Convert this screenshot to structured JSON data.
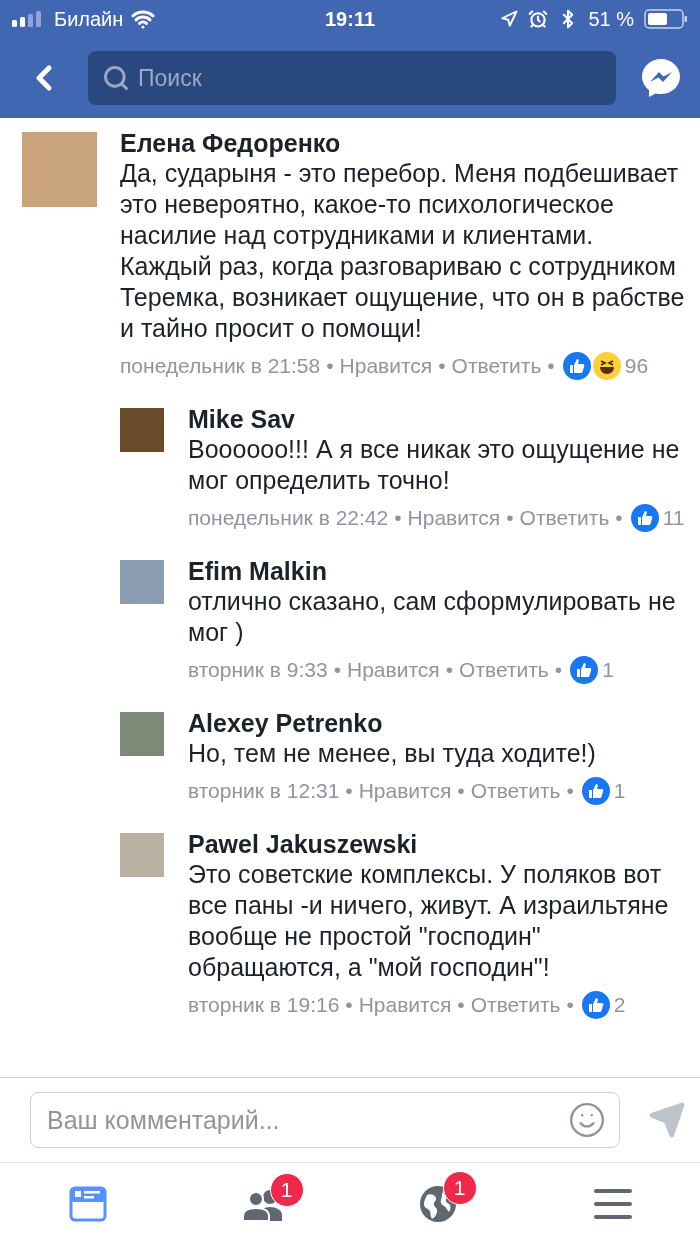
{
  "status_bar": {
    "carrier": "Билайн",
    "time": "19:11",
    "battery": "51 %"
  },
  "nav": {
    "search": {
      "placeholder": "Поиск"
    }
  },
  "comments": [
    {
      "author": "Елена Федоренко",
      "text": "Да, сударыня - это перебор. Меня подбешивает это невероятно, какое-то психологическое насилие над сотрудниками и клиентами. Каждый раз, когда разговариваю с сотрудником Теремка, возникает ощущение, что он в рабстве и тайно просит о помощи!",
      "time": "понедельник в 21:58",
      "like": "Нравится",
      "reply": "Ответить",
      "separator": "•",
      "reactions": [
        {
          "kind": "like"
        },
        {
          "kind": "haha"
        }
      ],
      "count": "96",
      "replies": [
        {
          "author": "Mike Sav",
          "text": "Boooooo!!! А я все никак это ощущение не мог определить точно!",
          "time": "понедельник в 22:42",
          "like": "Нравится",
          "reply": "Ответить",
          "separator": "•",
          "reactions": [
            {
              "kind": "like"
            }
          ],
          "count": "11"
        },
        {
          "author": "Efim Malkin",
          "text": "отлично сказано, сам сформулировать не мог )",
          "time": "вторник в 9:33",
          "like": "Нравится",
          "reply": "Ответить",
          "separator": "•",
          "reactions": [
            {
              "kind": "like"
            }
          ],
          "count": "1"
        },
        {
          "author": "Alexey Petrenko",
          "text": "Но, тем не менее, вы туда ходите!)",
          "time": "вторник в 12:31",
          "like": "Нравится",
          "reply": "Ответить",
          "separator": "•",
          "reactions": [
            {
              "kind": "like"
            }
          ],
          "count": "1"
        },
        {
          "author": "Pawel Jakuszewski",
          "text": "Это советские комплексы. У поляков вот все паны -и ничего, живут. А израильтяне вообще не простой \"господин\" обращаются, а \"мой господин\"!",
          "time": "вторник в 19:16",
          "like": "Нравится",
          "reply": "Ответить",
          "separator": "•",
          "reactions": [
            {
              "kind": "like"
            }
          ],
          "count": "2"
        }
      ]
    }
  ],
  "composer": {
    "placeholder": "Ваш комментарий..."
  },
  "tab_bar": [
    {
      "kind": "feed",
      "selected": true
    },
    {
      "kind": "friends",
      "selected": false,
      "badge": "1"
    },
    {
      "kind": "notifications",
      "selected": false,
      "badge": "1"
    },
    {
      "kind": "menu",
      "selected": false
    }
  ]
}
